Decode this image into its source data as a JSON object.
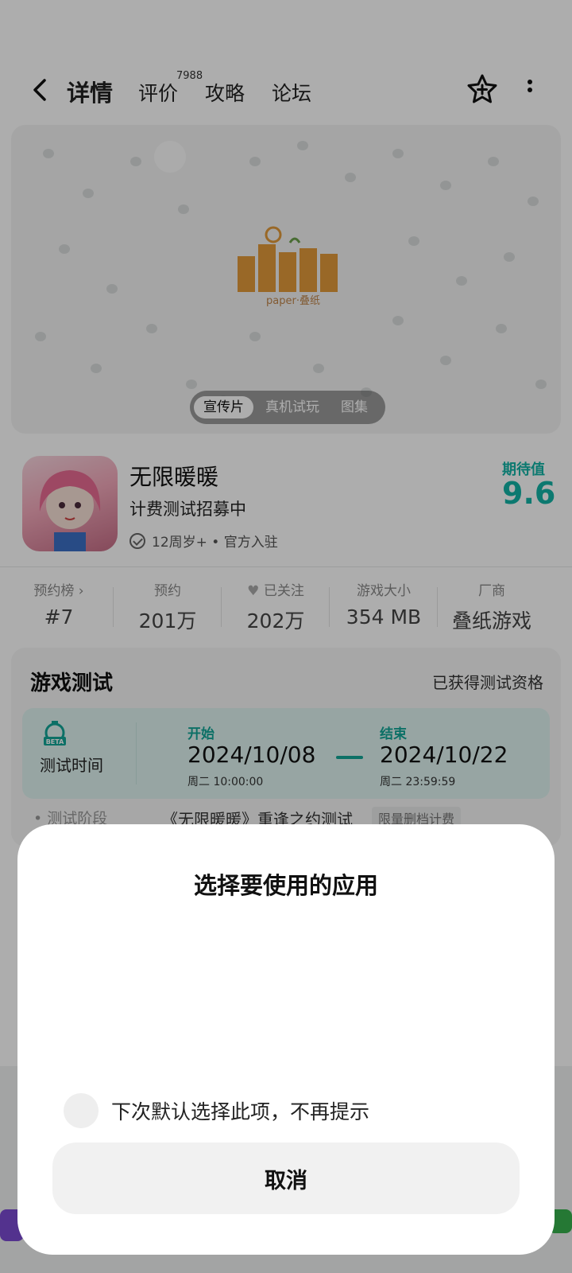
{
  "header": {
    "tabs": [
      {
        "label": "详情",
        "active": true
      },
      {
        "label": "评价",
        "active": false
      },
      {
        "label": "攻略",
        "active": false
      },
      {
        "label": "论坛",
        "active": false
      }
    ],
    "review_count": "7988",
    "icons": [
      "back-arrow-icon",
      "star-plus-icon",
      "more-vertical-icon"
    ]
  },
  "banner": {
    "logo_text": "paper·叠纸",
    "media_tabs": [
      {
        "label": "宣传片",
        "active": true
      },
      {
        "label": "真机试玩",
        "active": false
      },
      {
        "label": "图集",
        "active": false
      }
    ]
  },
  "app": {
    "name": "无限暖暖",
    "subtitle": "计费测试招募中",
    "meta": "12周岁+ • 官方入驻",
    "expect_label": "期待值",
    "expect_value": "9.6"
  },
  "stats": [
    {
      "label": "预约榜 ›",
      "value": "#7"
    },
    {
      "label": "预约",
      "value": "201万"
    },
    {
      "label": "已关注",
      "value": "202万"
    },
    {
      "label": "游戏大小",
      "value": "354 MB"
    },
    {
      "label": "厂商",
      "value": "叠纸游戏"
    }
  ],
  "test": {
    "title": "游戏测试",
    "status": "已获得测试资格",
    "time_label": "测试时间",
    "start_label": "开始",
    "start_date": "2024/10/08",
    "start_sub": "周二  10:00:00",
    "end_label": "结束",
    "end_date": "2024/10/22",
    "end_sub": "周二  23:59:59",
    "stage_label": "测试阶段",
    "stage_text": "《无限暖暖》重逢之约测试",
    "stage_tag": "限量删档计费"
  },
  "sheet": {
    "title": "选择要使用的应用",
    "remember_label": "下次默认选择此项，不再提示",
    "cancel_label": "取消"
  },
  "colors": {
    "accent": "#12b3a5",
    "scrim": "rgba(0,0,0,0.32)"
  }
}
